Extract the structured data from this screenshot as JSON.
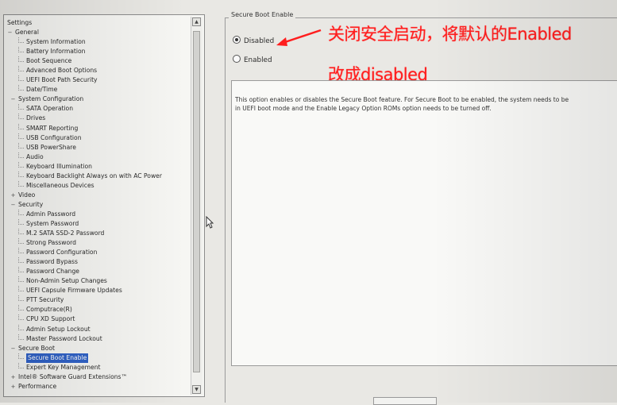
{
  "tree": [
    {
      "label": "Settings",
      "depth": 0,
      "expander": ""
    },
    {
      "label": "General",
      "depth": 0,
      "expander": "−"
    },
    {
      "label": "System Information",
      "depth": 2,
      "expander": ""
    },
    {
      "label": "Battery Information",
      "depth": 2,
      "expander": ""
    },
    {
      "label": "Boot Sequence",
      "depth": 2,
      "expander": ""
    },
    {
      "label": "Advanced Boot Options",
      "depth": 2,
      "expander": ""
    },
    {
      "label": "UEFI Boot Path Security",
      "depth": 2,
      "expander": ""
    },
    {
      "label": "Date/Time",
      "depth": 2,
      "expander": ""
    },
    {
      "label": "System Configuration",
      "depth": 1,
      "expander": "−"
    },
    {
      "label": "SATA Operation",
      "depth": 2,
      "expander": ""
    },
    {
      "label": "Drives",
      "depth": 2,
      "expander": ""
    },
    {
      "label": "SMART Reporting",
      "depth": 2,
      "expander": ""
    },
    {
      "label": "USB Configuration",
      "depth": 2,
      "expander": ""
    },
    {
      "label": "USB PowerShare",
      "depth": 2,
      "expander": ""
    },
    {
      "label": "Audio",
      "depth": 2,
      "expander": ""
    },
    {
      "label": "Keyboard Illumination",
      "depth": 2,
      "expander": ""
    },
    {
      "label": "Keyboard Backlight Always on with AC Power",
      "depth": 2,
      "expander": ""
    },
    {
      "label": "Miscellaneous Devices",
      "depth": 2,
      "expander": ""
    },
    {
      "label": "Video",
      "depth": 1,
      "expander": "+"
    },
    {
      "label": "Security",
      "depth": 1,
      "expander": "−"
    },
    {
      "label": "Admin Password",
      "depth": 2,
      "expander": ""
    },
    {
      "label": "System Password",
      "depth": 2,
      "expander": ""
    },
    {
      "label": "M.2 SATA SSD-2 Password",
      "depth": 2,
      "expander": ""
    },
    {
      "label": "Strong Password",
      "depth": 2,
      "expander": ""
    },
    {
      "label": "Password Configuration",
      "depth": 2,
      "expander": ""
    },
    {
      "label": "Password Bypass",
      "depth": 2,
      "expander": ""
    },
    {
      "label": "Password Change",
      "depth": 2,
      "expander": ""
    },
    {
      "label": "Non-Admin Setup Changes",
      "depth": 2,
      "expander": ""
    },
    {
      "label": "UEFI Capsule Firmware Updates",
      "depth": 2,
      "expander": ""
    },
    {
      "label": "PTT Security",
      "depth": 2,
      "expander": ""
    },
    {
      "label": "Computrace(R)",
      "depth": 2,
      "expander": ""
    },
    {
      "label": "CPU XD Support",
      "depth": 2,
      "expander": ""
    },
    {
      "label": "Admin Setup Lockout",
      "depth": 2,
      "expander": ""
    },
    {
      "label": "Master Password Lockout",
      "depth": 2,
      "expander": ""
    },
    {
      "label": "Secure Boot",
      "depth": 1,
      "expander": "−"
    },
    {
      "label": "Secure Boot Enable",
      "depth": 2,
      "expander": "",
      "selected": true
    },
    {
      "label": "Expert Key Management",
      "depth": 2,
      "expander": ""
    },
    {
      "label": "Intel® Software Guard Extensions™",
      "depth": 1,
      "expander": "+"
    },
    {
      "label": "Performance",
      "depth": 1,
      "expander": "+"
    }
  ],
  "group_title": "Secure Boot Enable",
  "options": [
    {
      "label": "Disabled",
      "checked": true
    },
    {
      "label": "Enabled",
      "checked": false
    }
  ],
  "description": "This option enables or disables the Secure Boot feature. For Secure Boot to be enabled, the system needs to be\nin UEFI boot mode and the Enable Legacy Option ROMs option needs to be turned off.",
  "annotation_line1": "关闭安全启动，将默认的Enabled",
  "annotation_line2": "改成disabled",
  "colors": {
    "annotation": "#ff1e1e",
    "selection": "#3163c8"
  },
  "icons": {
    "scroll_up": "scroll-up-arrow-icon",
    "scroll_down": "scroll-down-arrow-icon",
    "cursor": "mouse-cursor-icon",
    "pointer": "red-arrow-icon"
  }
}
